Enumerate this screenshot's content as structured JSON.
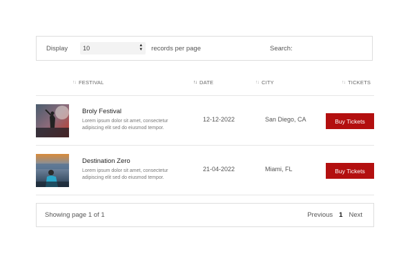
{
  "controls": {
    "display_label": "Display",
    "page_size": "10",
    "records_per_page_label": "records per page",
    "search_label": "Search:",
    "search_value": ""
  },
  "table": {
    "headers": {
      "festival": "FESTIVAL",
      "date": "DATE",
      "city": "CITY",
      "tickets": "TICKETS"
    },
    "rows": [
      {
        "thumb_icon": "concert-photo",
        "name": "Broly Festival",
        "desc_line1": "Lorem ipsum dolor sit amet, consectetur",
        "desc_line2": "adipiscing elit sed do eiusmod tempor.",
        "date": "12-12-2022",
        "city": "San Diego, CA",
        "button": "Buy Tickets"
      },
      {
        "thumb_icon": "dj-photo",
        "name": "Destination Zero",
        "desc_line1": "Lorem ipsum dolor sit amet, consectetur",
        "desc_line2": "adipiscing elit sed do eiusmod tempor.",
        "date": "21-04-2022",
        "city": "Miami, FL",
        "button": "Buy Tickets"
      }
    ]
  },
  "footer": {
    "info": "Showing page 1 of 1",
    "previous": "Previous",
    "current_page": "1",
    "next": "Next"
  },
  "colors": {
    "accent": "#b30f0f",
    "border": "#dddddd"
  }
}
